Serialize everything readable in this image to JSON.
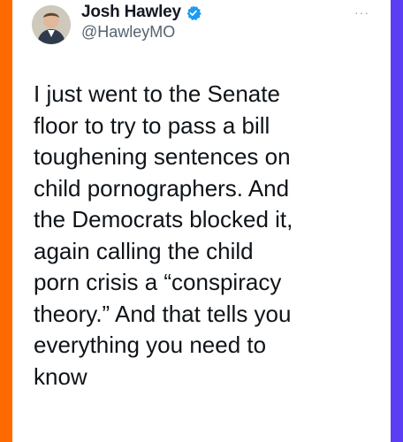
{
  "tweet": {
    "author": {
      "name": "Josh Hawley",
      "handle": "@HawleyMO"
    },
    "more_menu": "···",
    "text": "I just went to the Senate\nfloor to try to pass a bill\ntoughening sentences on\nchild pornographers. And\nthe Democrats blocked it,\nagain calling the child\nporn crisis a “conspiracy\ntheory.” And that tells you\neverything you need to\nknow"
  },
  "icons": {
    "verified": "verified-badge-icon",
    "more": "more-dots-icon"
  },
  "colors": {
    "left_border": "#ff6a00",
    "right_border": "#5b3df5",
    "verified": "#1d9bf0",
    "text": "#0f1419",
    "handle": "#536471"
  }
}
